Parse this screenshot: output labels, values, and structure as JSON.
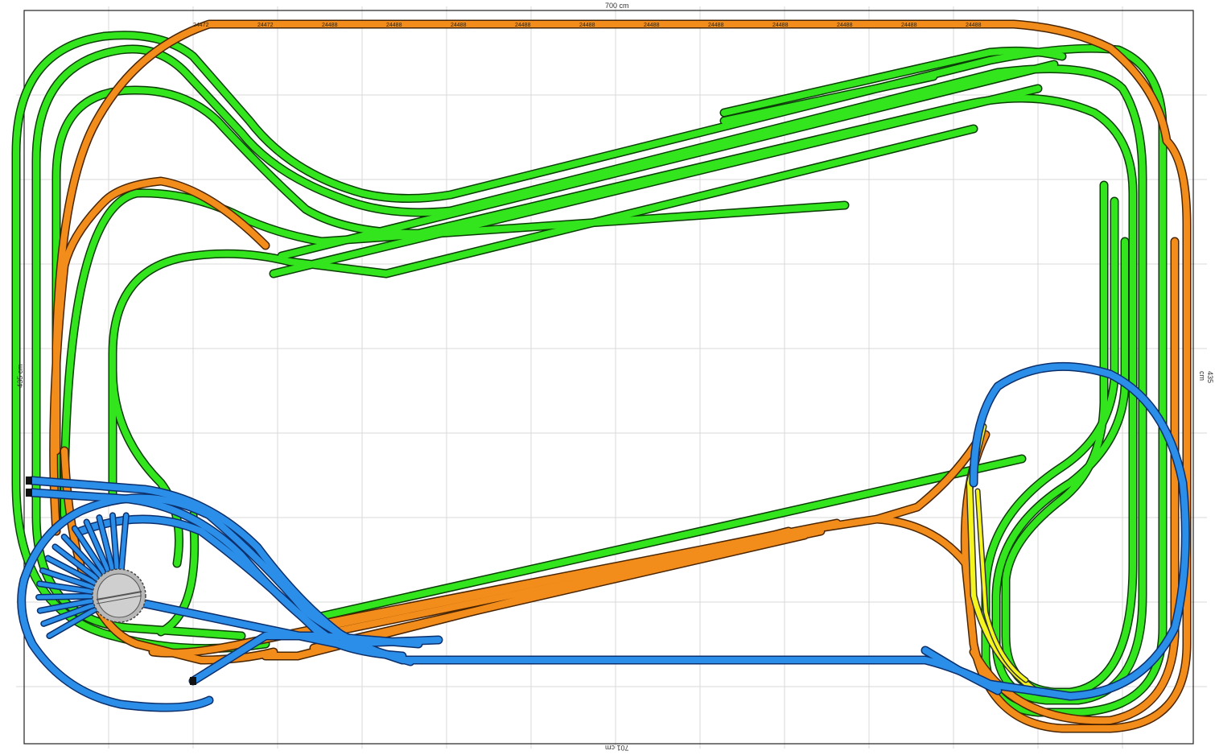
{
  "dimensions": {
    "top": "700 cm",
    "bottom": "701 cm",
    "right": "435 cm",
    "left": "435 cm"
  },
  "track_labels": [
    "24472",
    "24480",
    "24488",
    "24412"
  ],
  "colors": {
    "level_green": "#33e51d",
    "level_orange": "#f28c1a",
    "level_blue": "#2b8ee8",
    "level_yellow": "#f4f41f",
    "turntable": "#c8c8c8",
    "grid": "#d8d8d8",
    "outline": "#222222"
  },
  "turntable_stalls": 14
}
